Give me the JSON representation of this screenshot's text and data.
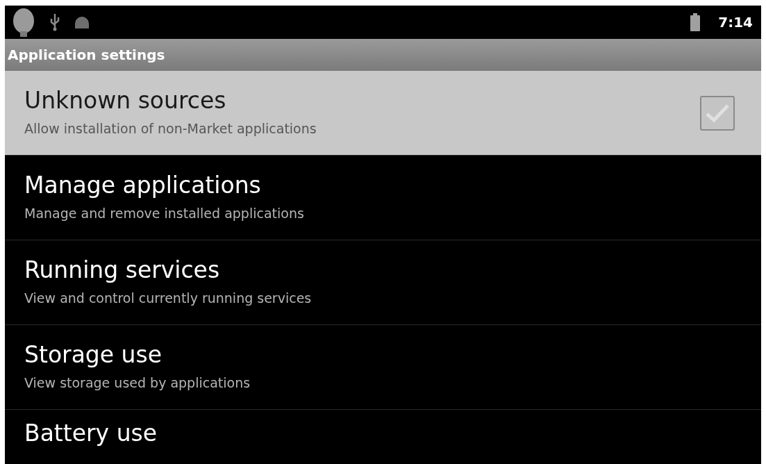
{
  "status_bar": {
    "time": "7:14"
  },
  "title_bar": {
    "title": "Application settings"
  },
  "items": [
    {
      "kind": "checkbox",
      "title": "Unknown sources",
      "summary": "Allow installation of non-Market applications",
      "selected": true,
      "checked": true
    },
    {
      "kind": "plain",
      "title": "Manage applications",
      "summary": "Manage and remove installed applications",
      "selected": false
    },
    {
      "kind": "plain",
      "title": "Running services",
      "summary": "View and control currently running services",
      "selected": false
    },
    {
      "kind": "plain",
      "title": "Storage use",
      "summary": "View storage used by applications",
      "selected": false
    },
    {
      "kind": "plain",
      "title": "Battery use",
      "selected": false
    }
  ]
}
